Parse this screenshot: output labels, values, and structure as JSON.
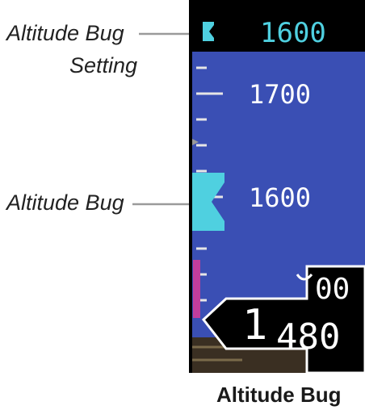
{
  "callouts": {
    "bug_setting_line1": "Altitude Bug",
    "bug_setting_line2": "Setting",
    "bug": "Altitude Bug"
  },
  "caption": "Altitude Bug",
  "display": {
    "bug_setting_value": "1600",
    "tape_labels": [
      "1700",
      "1600"
    ],
    "readout_big": "1",
    "readout_upper": "00",
    "readout_lower": "480"
  },
  "colors": {
    "tape_blue": "#3a4fb4",
    "bug_cyan": "#4fd0e0",
    "trend_magenta": "#c23d9c",
    "leader_gray": "#9a9a9a"
  }
}
